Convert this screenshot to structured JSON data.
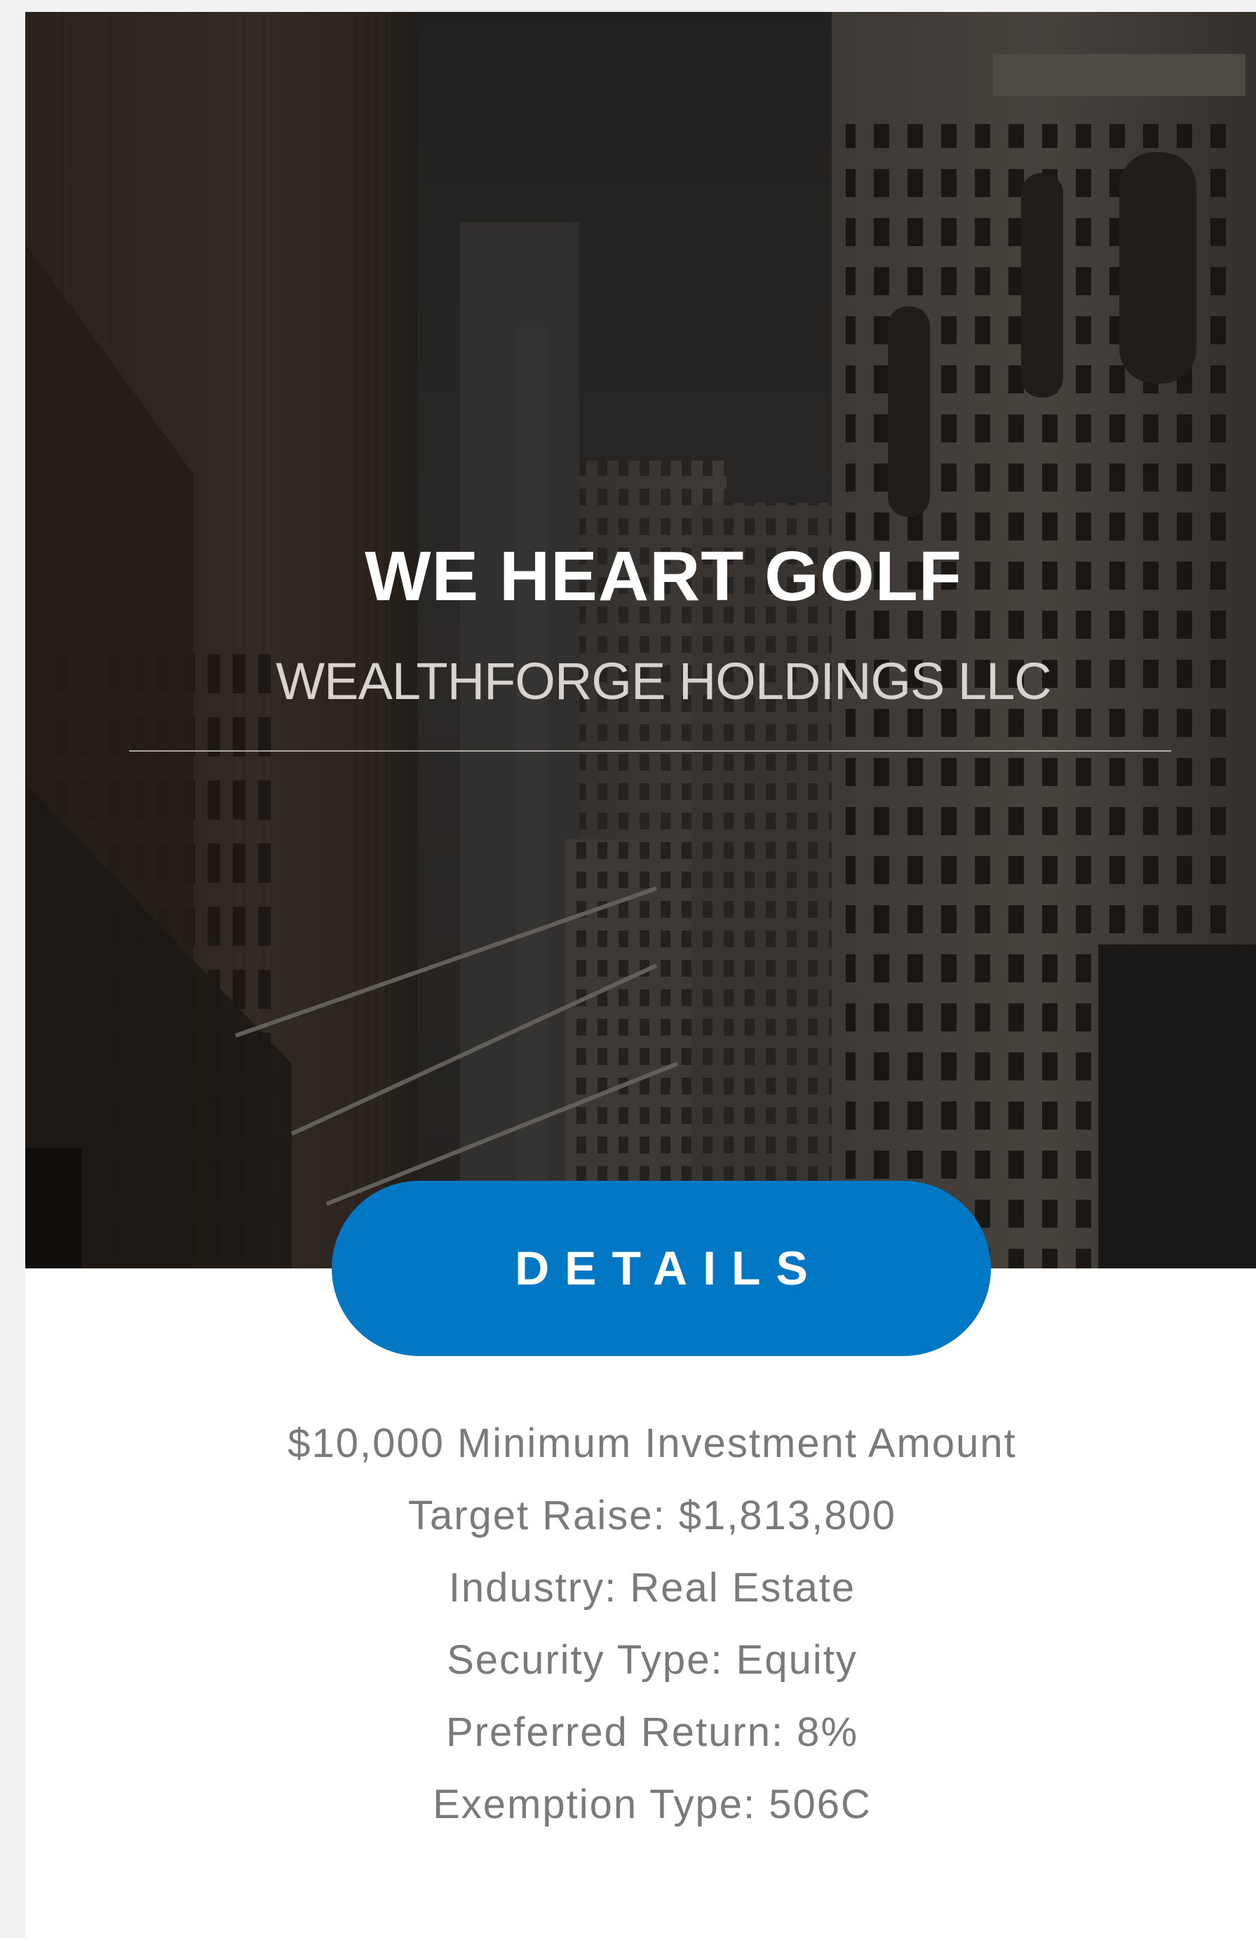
{
  "offering": {
    "title": "WE HEART GOLF",
    "issuer": "WEALTHFORGE HOLDINGS LLC",
    "details_button_label": "DETAILS",
    "hero_image": "city-buildings-photo"
  },
  "info": {
    "items": [
      "$10,000 Minimum Investment Amount",
      "Target Raise: $1,813,800",
      "Industry: Real Estate",
      "Security Type: Equity",
      "Preferred Return: 8%",
      "Exemption Type: 506C"
    ]
  },
  "colors": {
    "button": "#0277c3",
    "info_text": "#7a7a7a",
    "title_text": "#ffffff",
    "subtitle_text": "#d8d3cf"
  }
}
